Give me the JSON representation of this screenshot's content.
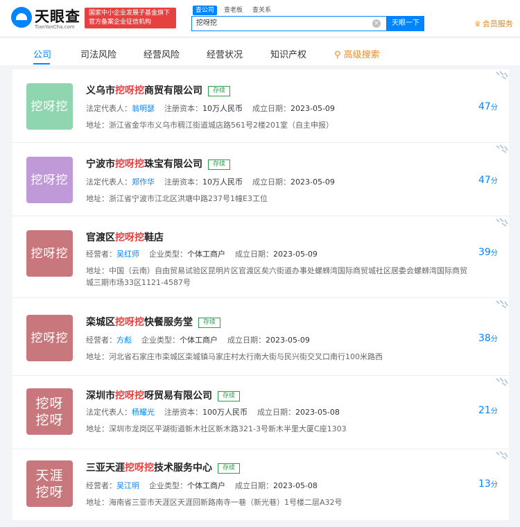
{
  "header": {
    "logo_cn": "天眼查",
    "logo_en": "TianYanCha.com",
    "badge_line1": "国家中小企业发展子基金旗下",
    "badge_line2": "官方备案企业征信机构",
    "search_tabs": [
      "查公司",
      "查老板",
      "查关系"
    ],
    "search_value": "挖呀挖",
    "search_button": "天眼一下",
    "vip_label": "会员服务"
  },
  "nav": {
    "items": [
      "公司",
      "司法风险",
      "经营风险",
      "经营状况",
      "知识产权"
    ],
    "advanced": "高级搜索"
  },
  "results": [
    {
      "logo_text": "挖呀挖",
      "logo_color": "#8fd5b0",
      "name_pre": "义乌市",
      "name_hl": "挖呀挖",
      "name_post": "商贸有限公司",
      "status": "存续",
      "person_label": "法定代表人：",
      "person": "翁明瑟",
      "f2_label": "注册资本：",
      "f2_value": "10万人民币",
      "date_label": "成立日期：",
      "date": "2023-05-09",
      "address_label": "地址：",
      "address": "浙江省金华市义乌市稠江街道城店路561号2楼201室（自主申报）",
      "score": "47",
      "score_unit": "分"
    },
    {
      "logo_text": "挖呀挖",
      "logo_color": "#c09ad8",
      "name_pre": "宁波市",
      "name_hl": "挖呀挖",
      "name_post": "珠宝有限公司",
      "status": "存续",
      "person_label": "法定代表人：",
      "person": "郑作华",
      "f2_label": "注册资本：",
      "f2_value": "10万人民币",
      "date_label": "成立日期：",
      "date": "2023-05-09",
      "address_label": "地址：",
      "address": "浙江省宁波市江北区洪塘中路237号1幢E3工位",
      "score": "47",
      "score_unit": "分"
    },
    {
      "logo_text": "挖呀挖",
      "logo_color": "#c8787c",
      "name_pre": "官渡区",
      "name_hl": "挖呀挖",
      "name_post": "鞋店",
      "status": "",
      "person_label": "经营者：",
      "person": "吴红师",
      "f2_label": "企业类型：",
      "f2_value": "个体工商户",
      "date_label": "成立日期：",
      "date": "2023-05-09",
      "address_label": "地址：",
      "address": "中国（云南）自由贸易试验区昆明片区官渡区矣六街道办事处螺蛳湾国际商贸城社区居委会螺蛳湾国际商贸城三期市场33区1121-4587号",
      "score": "39",
      "score_unit": "分"
    },
    {
      "logo_text": "挖呀挖",
      "logo_color": "#c8787c",
      "name_pre": "栾城区",
      "name_hl": "挖呀挖",
      "name_post": "快餐服务堂",
      "status": "存续",
      "person_label": "经营者：",
      "person": "方彪",
      "f2_label": "企业类型：",
      "f2_value": "个体工商户",
      "date_label": "成立日期：",
      "date": "2023-05-09",
      "address_label": "地址：",
      "address": "河北省石家庄市栾城区栾城镇马家庄村太行南大街与民兴街交叉口南行100米路西",
      "score": "38",
      "score_unit": "分"
    },
    {
      "logo_text": "挖呀\n挖呀",
      "logo_color": "#c8787c",
      "name_pre": "深圳市",
      "name_hl": "挖呀挖",
      "name_post": "呀贸易有限公司",
      "status": "存续",
      "person_label": "法定代表人：",
      "person": "杨耀光",
      "f2_label": "注册资本：",
      "f2_value": "100万人民币",
      "date_label": "成立日期：",
      "date": "2023-05-08",
      "address_label": "地址：",
      "address": "深圳市龙岗区平湖街道新木社区新木路321-3号新木半里大厦C座1303",
      "score": "21",
      "score_unit": "分"
    },
    {
      "logo_text": "天涯\n挖呀",
      "logo_color": "#c8787c",
      "name_pre": "三亚天涯",
      "name_hl": "挖呀挖",
      "name_post": "技术服务中心",
      "status": "存续",
      "person_label": "经营者：",
      "person": "吴江明",
      "f2_label": "企业类型：",
      "f2_value": "个体工商户",
      "date_label": "成立日期：",
      "date": "2023-05-08",
      "address_label": "地址：",
      "address": "海南省三亚市天涯区天涯回新路南寺一巷（新光巷）1号楼二层A32号",
      "score": "13",
      "score_unit": "分"
    }
  ]
}
